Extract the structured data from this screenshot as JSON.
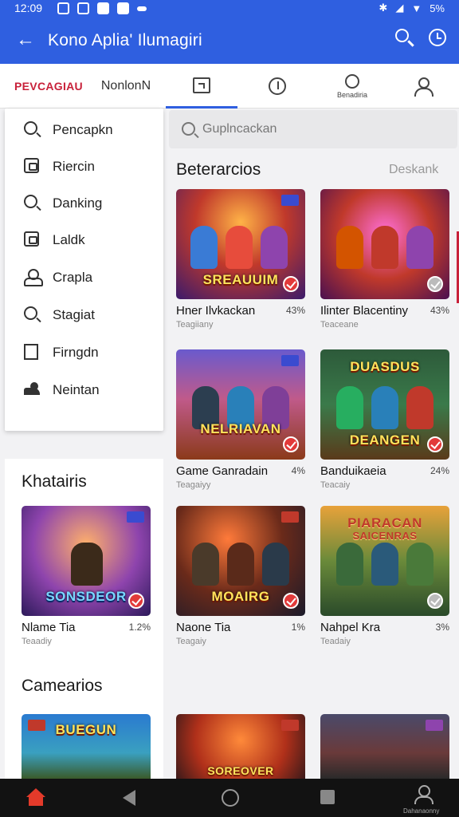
{
  "status_bar": {
    "time": "12:09",
    "battery": "5%"
  },
  "app_bar": {
    "title": "Kono Aplia' Ilumagiri"
  },
  "tabs": {
    "t1": "PEVCAGIAU",
    "t2": "NonlonN",
    "i3_label": "Benadiria"
  },
  "menu": {
    "items": [
      {
        "label": "Pencapkn",
        "icon": "search-icon"
      },
      {
        "label": "Riercin",
        "icon": "box-icon"
      },
      {
        "label": "Danking",
        "icon": "search-icon"
      },
      {
        "label": "Laldk",
        "icon": "box-icon"
      },
      {
        "label": "Crapla",
        "icon": "user-icon"
      },
      {
        "label": "Stagiat",
        "icon": "search-icon"
      },
      {
        "label": "Firngdn",
        "icon": "square-icon"
      },
      {
        "label": "Neintan",
        "icon": "cloud-icon"
      }
    ]
  },
  "search": {
    "placeholder": "Guplncackan"
  },
  "sections": {
    "main_title": "Beterarcios",
    "main_link": "Deskank",
    "left_title": "Khatairis",
    "lower_title": "Camearios"
  },
  "cards": [
    {
      "name": "Hner Ilvkackan",
      "pct": "43%",
      "sub": "Teagiiany",
      "banner": "SREAUUIM"
    },
    {
      "name": "Ilinter Blacentiny",
      "pct": "43%",
      "sub": "Teaceane",
      "banner": ""
    },
    {
      "name": "Game Ganradain",
      "pct": "4%",
      "sub": "Teagaiyy",
      "banner": "NELRIAVAN"
    },
    {
      "name": "Banduikaeia",
      "pct": "24%",
      "sub": "Teacaiy",
      "banner": "DUASDUS"
    },
    {
      "name": "Nlame Tia",
      "pct": "1.2%",
      "sub": "Teaadiy",
      "banner": "SONSDEOR"
    },
    {
      "name": "Naone Tia",
      "pct": "1%",
      "sub": "Teagaiy",
      "banner": "MOAIRG"
    },
    {
      "name": "Nahpel Kra",
      "pct": "3%",
      "sub": "Teadaiy",
      "banner": "PIARACAN"
    },
    {
      "banner": "BUEGUN"
    },
    {
      "banner": "SOREOVER"
    },
    {
      "banner": ""
    }
  ],
  "extra_banners": {
    "c4_bottom": "DEANGEN",
    "c7_bottom": "SAICENRAS"
  },
  "bottom_nav": {
    "profile_label": "Dahanaonny"
  },
  "colors": {
    "primary": "#2f5fe0",
    "accent": "#c8213a",
    "nav_bg": "#121212"
  }
}
